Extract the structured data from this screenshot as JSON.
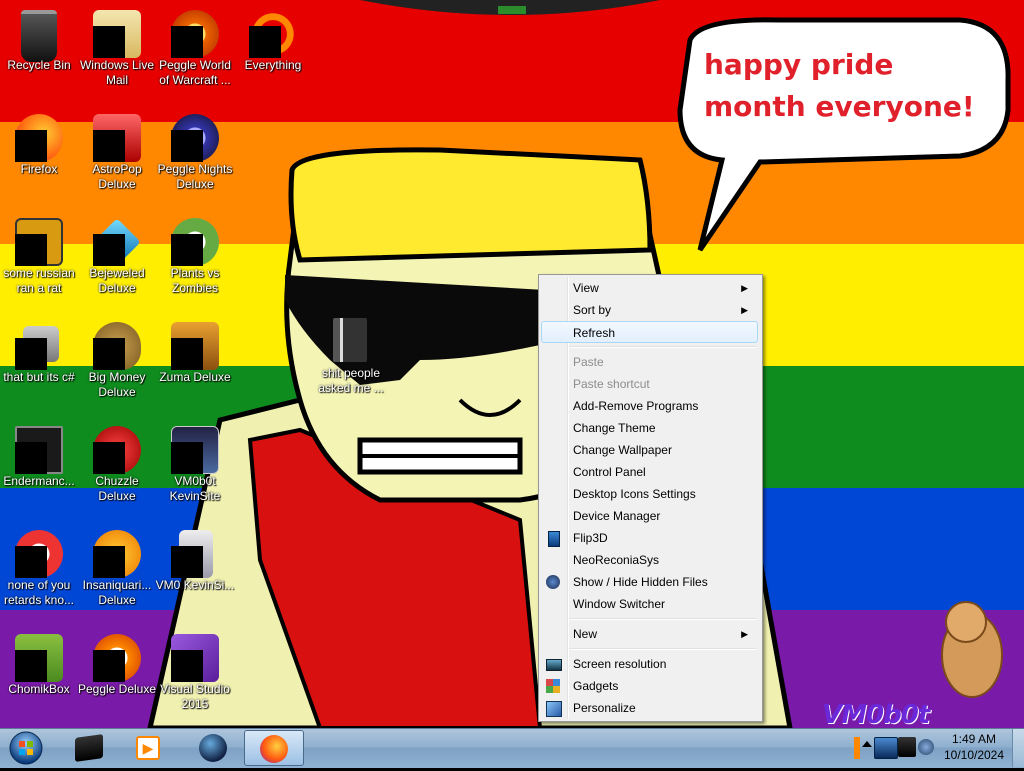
{
  "wallpaper": {
    "speech_bubble_text": "happy pride month everyone!",
    "stripe_colors": [
      "#e60000",
      "#ff8800",
      "#ffee00",
      "#0f8c1e",
      "#0047d6",
      "#7a1aa8"
    ],
    "watermark": "VM0b0t"
  },
  "desktop": {
    "icons": [
      {
        "label": "Recycle Bin",
        "icon": "recycle-bin-icon"
      },
      {
        "label": "Windows Live Mail",
        "icon": "mail-icon"
      },
      {
        "label": "Peggle World of Warcraft ...",
        "icon": "peggle-icon"
      },
      {
        "label": "Everything",
        "icon": "everything-search-icon"
      },
      {
        "label": "Firefox",
        "icon": "firefox-icon"
      },
      {
        "label": "AstroPop Deluxe",
        "icon": "astropop-icon"
      },
      {
        "label": "Peggle Nights Deluxe",
        "icon": "peggle-nights-icon"
      },
      {
        "label": "some russian ran a rat",
        "icon": "game-icon"
      },
      {
        "label": "Bejeweled Deluxe",
        "icon": "bejeweled-icon"
      },
      {
        "label": "Plants vs Zombies",
        "icon": "plants-vs-zombies-icon"
      },
      {
        "label": "that but its c#",
        "icon": "program-icon"
      },
      {
        "label": "Big Money Deluxe",
        "icon": "money-bag-icon"
      },
      {
        "label": "Zuma Deluxe",
        "icon": "zuma-icon"
      },
      {
        "label": "shit people asked me ...",
        "icon": "folder-icon"
      },
      {
        "label": "Endermanc...",
        "icon": "terminal-icon"
      },
      {
        "label": "Chuzzle Deluxe",
        "icon": "chuzzle-icon"
      },
      {
        "label": "VM0b0t KevinSite",
        "icon": "website-icon"
      },
      {
        "label": "none of you retards kno...",
        "icon": "program-icon"
      },
      {
        "label": "Insaniquari... Deluxe",
        "icon": "insaniquarium-icon"
      },
      {
        "label": "VM0 KevinSi...",
        "icon": "website-icon"
      },
      {
        "label": "ChomikBox",
        "icon": "chomikbox-icon"
      },
      {
        "label": "Peggle Deluxe",
        "icon": "peggle-icon"
      },
      {
        "label": "Visual Studio 2015",
        "icon": "visual-studio-icon"
      }
    ]
  },
  "context_menu": {
    "items": [
      {
        "label": "View",
        "submenu": true
      },
      {
        "label": "Sort by",
        "submenu": true
      },
      {
        "label": "Refresh",
        "highlighted": true
      },
      {
        "label": "Paste",
        "disabled": true
      },
      {
        "label": "Paste shortcut",
        "disabled": true
      },
      {
        "label": "Add-Remove Programs"
      },
      {
        "label": "Change Theme"
      },
      {
        "label": "Change Wallpaper"
      },
      {
        "label": "Control Panel"
      },
      {
        "label": "Desktop Icons Settings"
      },
      {
        "label": "Device Manager"
      },
      {
        "label": "Flip3D",
        "icon": "flip3d-icon"
      },
      {
        "label": "NeoReconiaSys"
      },
      {
        "label": "Show / Hide Hidden Files",
        "icon": "hidden-files-icon"
      },
      {
        "label": "Window Switcher"
      },
      {
        "label": "New",
        "submenu": true
      },
      {
        "label": "Screen resolution",
        "icon": "screen-resolution-icon"
      },
      {
        "label": "Gadgets",
        "icon": "gadgets-icon"
      },
      {
        "label": "Personalize",
        "icon": "personalize-icon"
      }
    ]
  },
  "taskbar": {
    "start_icon": "windows-orb-icon",
    "pinned": [
      "terminal-app-icon",
      "media-player-icon",
      "globe-app-icon",
      "firefox-icon"
    ],
    "active_app": "firefox-icon",
    "tray_icons": [
      "flag-icon",
      "network-icon",
      "volume-icon"
    ],
    "clock_time": "1:49 AM",
    "clock_date": "10/10/2024"
  }
}
